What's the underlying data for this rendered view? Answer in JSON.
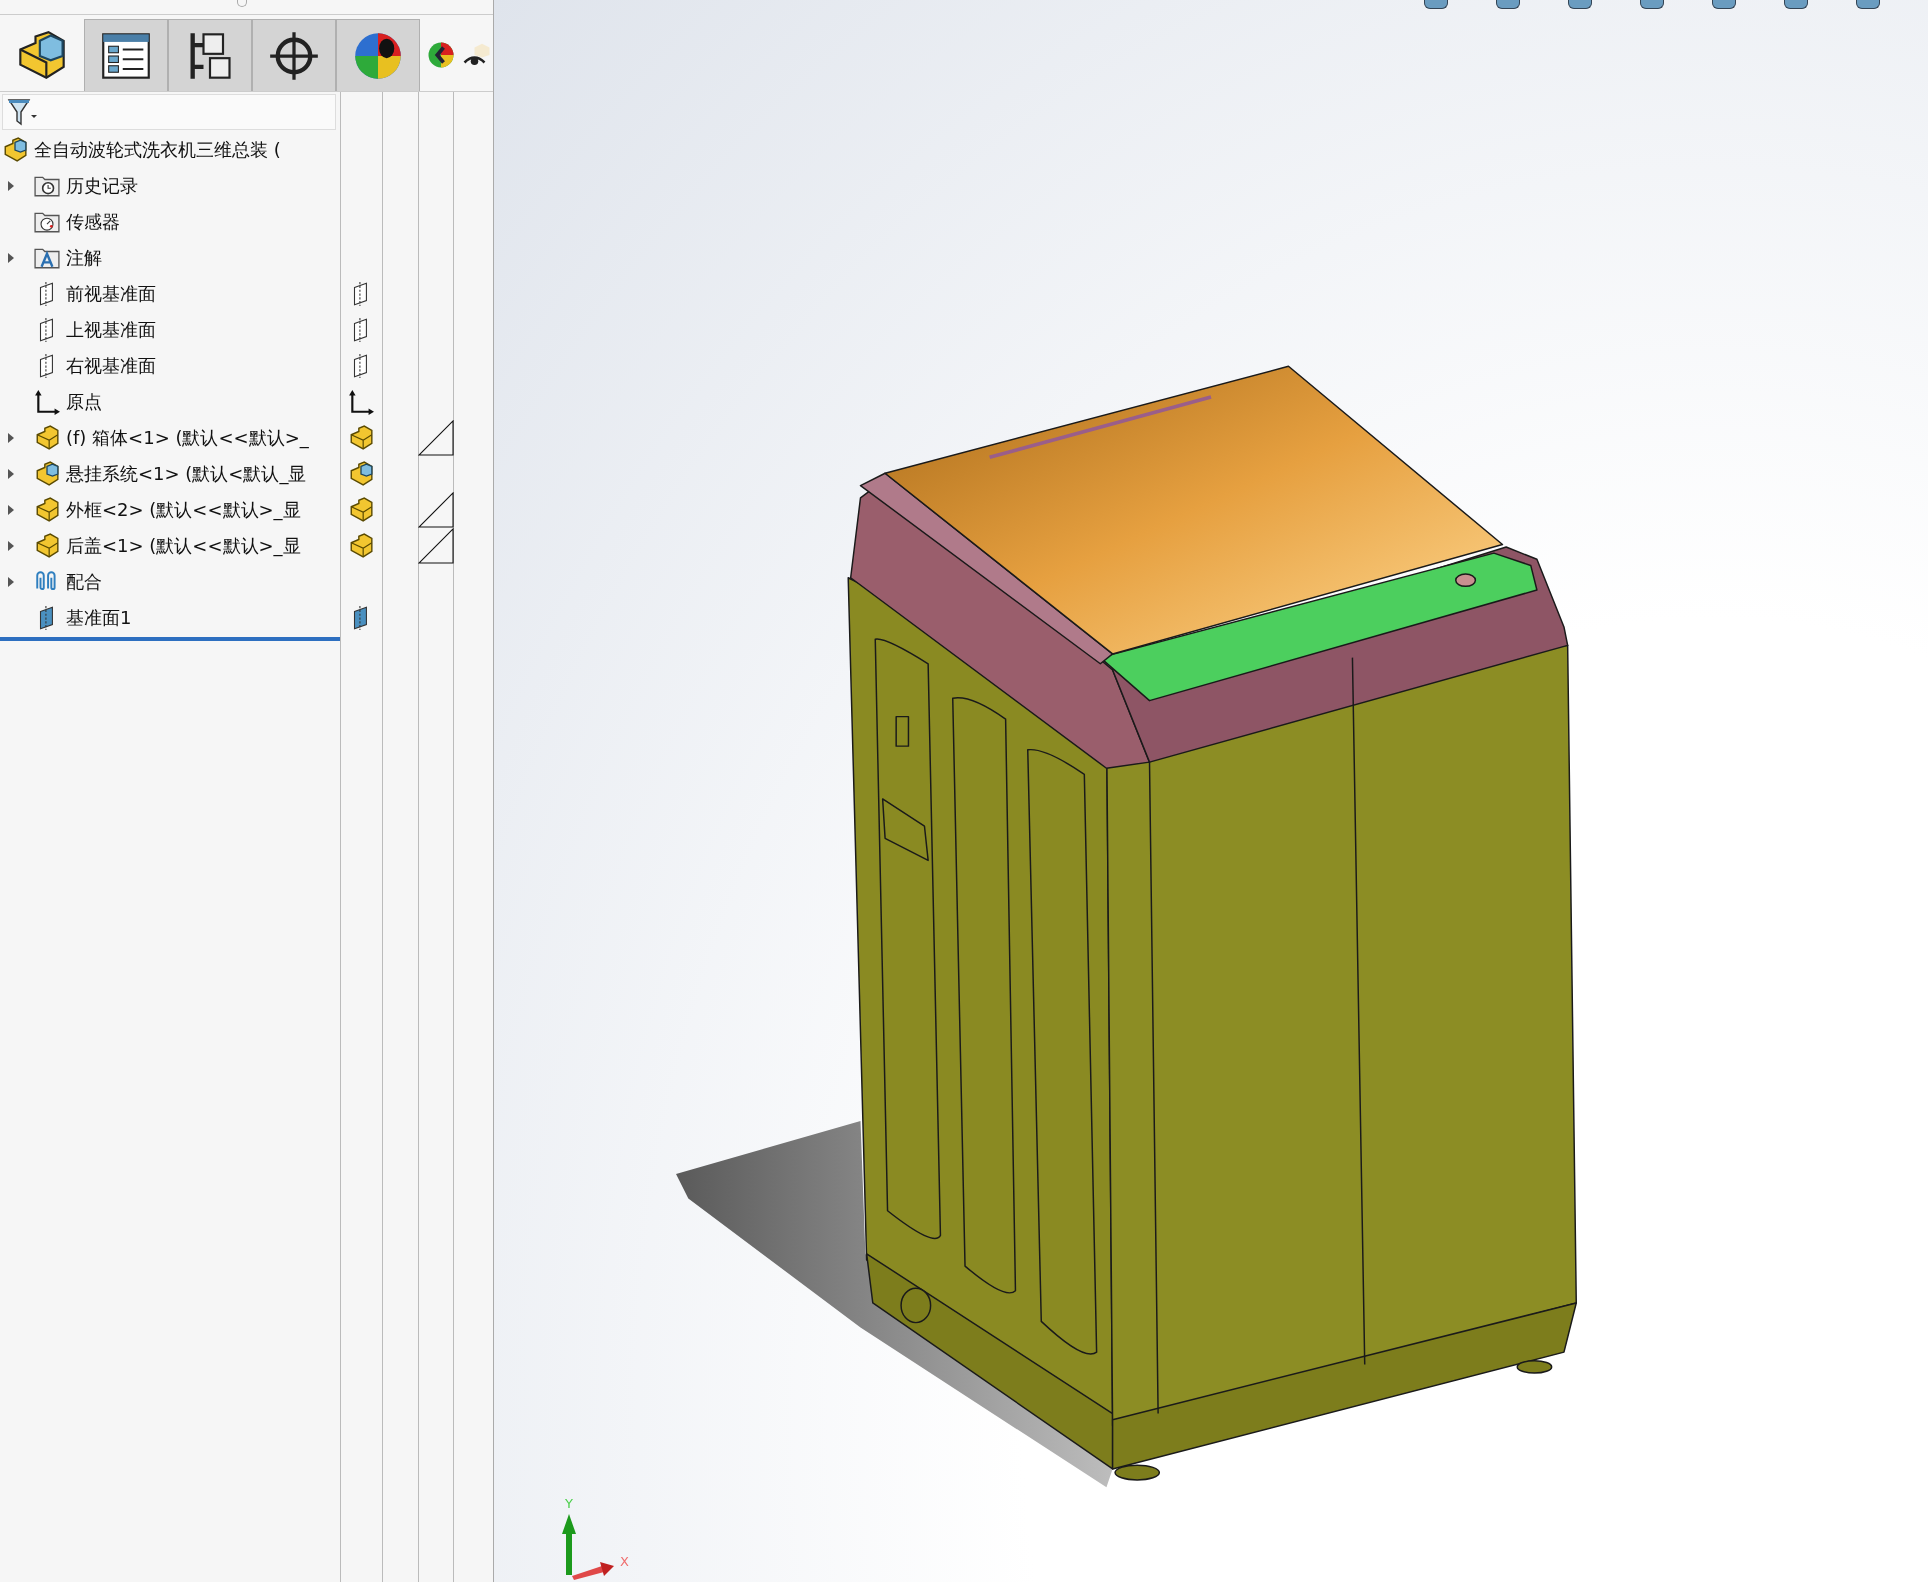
{
  "panel_tabs": [
    {
      "kind": "feature-tree",
      "selected": true
    },
    {
      "kind": "property-manager",
      "selected": false
    },
    {
      "kind": "configuration-manager",
      "selected": false
    },
    {
      "kind": "dimxpert",
      "selected": false
    },
    {
      "kind": "appearance",
      "selected": false
    }
  ],
  "feature_tree": {
    "root": {
      "label": "全自动波轮式洗衣机三维总装 (",
      "kind": "assembly",
      "children": [
        {
          "label": "历史记录",
          "kind": "history-folder",
          "expandable": true,
          "side_icon": false,
          "marker": false
        },
        {
          "label": "传感器",
          "kind": "sensor-folder",
          "expandable": false,
          "side_icon": false,
          "marker": false
        },
        {
          "label": "注解",
          "kind": "annotation-folder",
          "expandable": true,
          "side_icon": false,
          "marker": false
        },
        {
          "label": "前视基准面",
          "kind": "plane",
          "expandable": false,
          "side_icon": true,
          "marker": false
        },
        {
          "label": "上视基准面",
          "kind": "plane",
          "expandable": false,
          "side_icon": true,
          "marker": false
        },
        {
          "label": "右视基准面",
          "kind": "plane",
          "expandable": false,
          "side_icon": true,
          "marker": false
        },
        {
          "label": "原点",
          "kind": "origin",
          "expandable": false,
          "side_icon": true,
          "marker": false
        },
        {
          "label": "(f) 箱体<1> (默认<<默认>_",
          "kind": "part",
          "expandable": true,
          "side_icon": true,
          "marker": true
        },
        {
          "label": "悬挂系统<1> (默认<默认_显",
          "kind": "assembly",
          "expandable": true,
          "side_icon": true,
          "marker": false
        },
        {
          "label": "外框<2> (默认<<默认>_显",
          "kind": "part",
          "expandable": true,
          "side_icon": true,
          "marker": true
        },
        {
          "label": "后盖<1> (默认<<默认>_显",
          "kind": "part",
          "expandable": true,
          "side_icon": true,
          "marker": true
        },
        {
          "label": "配合",
          "kind": "mates",
          "expandable": true,
          "side_icon": false,
          "marker": false
        },
        {
          "label": "基准面1",
          "kind": "plane-solid",
          "expandable": false,
          "side_icon": true,
          "marker": false
        }
      ]
    }
  },
  "triad": {
    "y_label": "Y",
    "x_label": "X"
  }
}
